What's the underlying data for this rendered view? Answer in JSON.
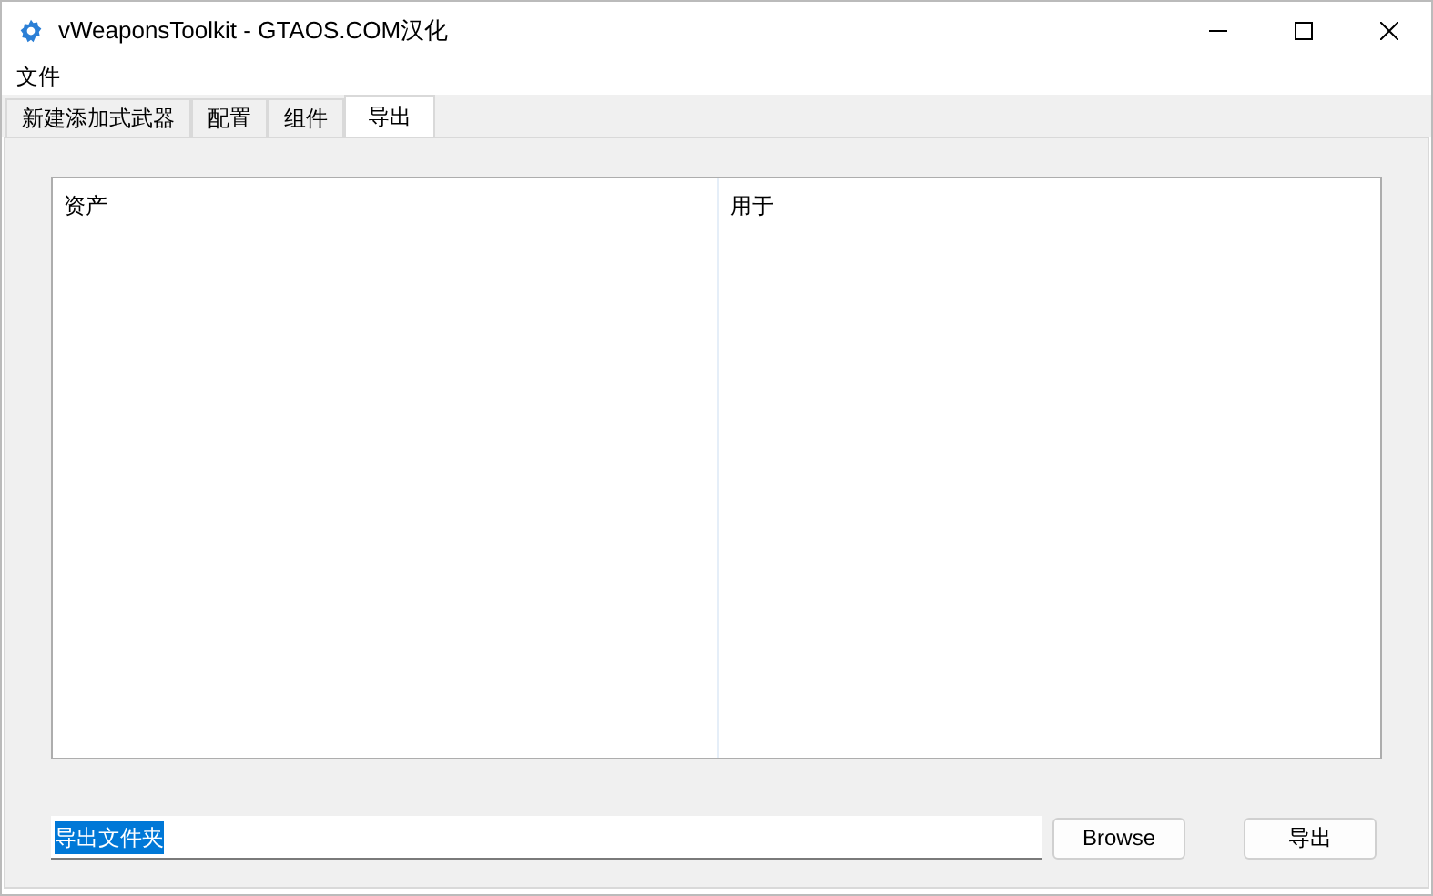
{
  "window": {
    "title": "vWeaponsToolkit - GTAOS.COM汉化"
  },
  "menu": [
    "文件"
  ],
  "tabs": [
    {
      "label": "新建添加式武器",
      "selected": false
    },
    {
      "label": "配置",
      "selected": false
    },
    {
      "label": "组件",
      "selected": false
    },
    {
      "label": "导出",
      "selected": true
    }
  ],
  "list": {
    "columns": [
      "资产",
      "用于"
    ]
  },
  "folder_field": {
    "value": "导出文件夹",
    "selected": true
  },
  "buttons": [
    "Browse",
    "导出"
  ]
}
